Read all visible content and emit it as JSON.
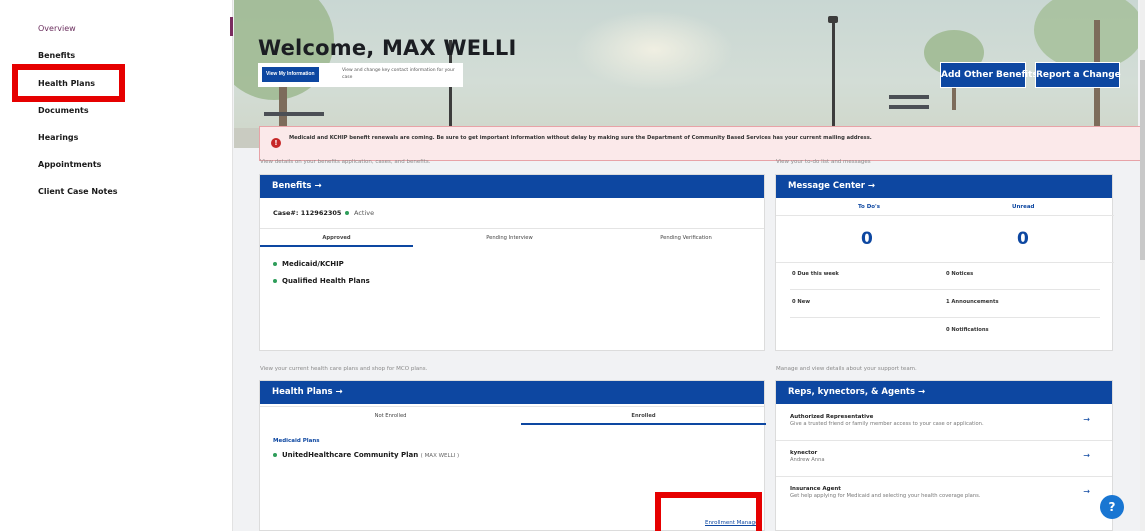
{
  "sidebar": {
    "items": [
      {
        "label": "Overview"
      },
      {
        "label": "Benefits"
      },
      {
        "label": "Health Plans"
      },
      {
        "label": "Documents"
      },
      {
        "label": "Hearings"
      },
      {
        "label": "Appointments"
      },
      {
        "label": "Client Case Notes"
      }
    ]
  },
  "hero": {
    "title": "Welcome, MAX WELLI",
    "view_info_button": "View My Information",
    "view_info_text": "View and change key contact information for your case",
    "add_benefits_button": "Add Other Benefits",
    "report_change_button": "Report a Change"
  },
  "alert": {
    "text": "Medicaid and KCHIP benefit renewals are coming. Be sure to get important information without delay by making sure the Department of Community Based Services has your current mailing address."
  },
  "benefits": {
    "caption": "View details on your benefits application, cases, and benefits.",
    "header": "Benefits →",
    "case_label": "Case#: 112962305",
    "status": "Active",
    "tabs": [
      "Approved",
      "Pending Interview",
      "Pending Verification"
    ],
    "items": [
      "Medicaid/KCHIP",
      "Qualified Health Plans"
    ]
  },
  "message_center": {
    "caption": "View your to-do list and messages",
    "header": "Message Center →",
    "todos_label": "To Do's",
    "unread_label": "Unread",
    "todos_count": "0",
    "unread_count": "0",
    "due_this_week": "0  Due this week",
    "new": "0  New",
    "notices": "0  Notices",
    "announcements": "1  Announcements",
    "notifications": "0  Notifications"
  },
  "health_plans": {
    "caption": "View your current health care plans and shop for MCO plans.",
    "header": "Health Plans →",
    "tabs": [
      "Not Enrolled",
      "Enrolled"
    ],
    "section_label": "Medicaid Plans",
    "plan_name": "UnitedHealthcare Community Plan",
    "plan_member": "( MAX WELLI )",
    "enrollment_link": "Enrollment Manager"
  },
  "reps": {
    "caption": "Manage and view details about your support team.",
    "header": "Reps, kynectors, & Agents →",
    "rows": [
      {
        "title": "Authorized Representative",
        "desc": "Give a trusted friend or family member access to your case or application."
      },
      {
        "title": "kynector",
        "desc": "Andrew Anna"
      },
      {
        "title": "Insurance Agent",
        "desc": "Get help applying for Medicaid and selecting your health coverage plans."
      }
    ]
  },
  "help_label": "?",
  "colors": {
    "brand_blue": "#0d47a1",
    "accent_purple": "#7a2d5f",
    "alert_red": "#c62828",
    "highlight_red": "#e60000",
    "active_green": "#2e9d5a"
  }
}
